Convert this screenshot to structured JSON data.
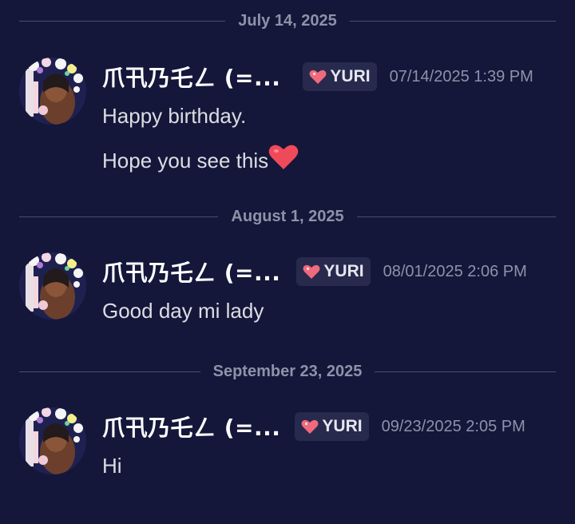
{
  "dividers": [
    {
      "date": "July 14, 2025"
    },
    {
      "date": "August 1, 2025"
    },
    {
      "date": "September 23, 2025"
    }
  ],
  "messages": [
    {
      "username": "爪卂乃乇ㄥ (=...",
      "tag": "YURI",
      "timestamp": "07/14/2025 1:39 PM",
      "lines": [
        "Happy birthday.",
        "Hope you see this"
      ],
      "emoji": "red-heart-icon"
    },
    {
      "username": "爪卂乃乇ㄥ (=...",
      "tag": "YURI",
      "timestamp": "08/01/2025 2:06 PM",
      "lines": [
        "Good day mi lady"
      ]
    },
    {
      "username": "爪卂乃乇ㄥ (=...",
      "tag": "YURI",
      "timestamp": "09/23/2025 2:05 PM",
      "lines": [
        "Hi"
      ]
    }
  ],
  "colors": {
    "background": "#14173a",
    "divider_line": "#4a4e6b",
    "muted_text": "#8e92a8",
    "tag_bg": "#272a4d",
    "heart": "#f04a5a"
  }
}
